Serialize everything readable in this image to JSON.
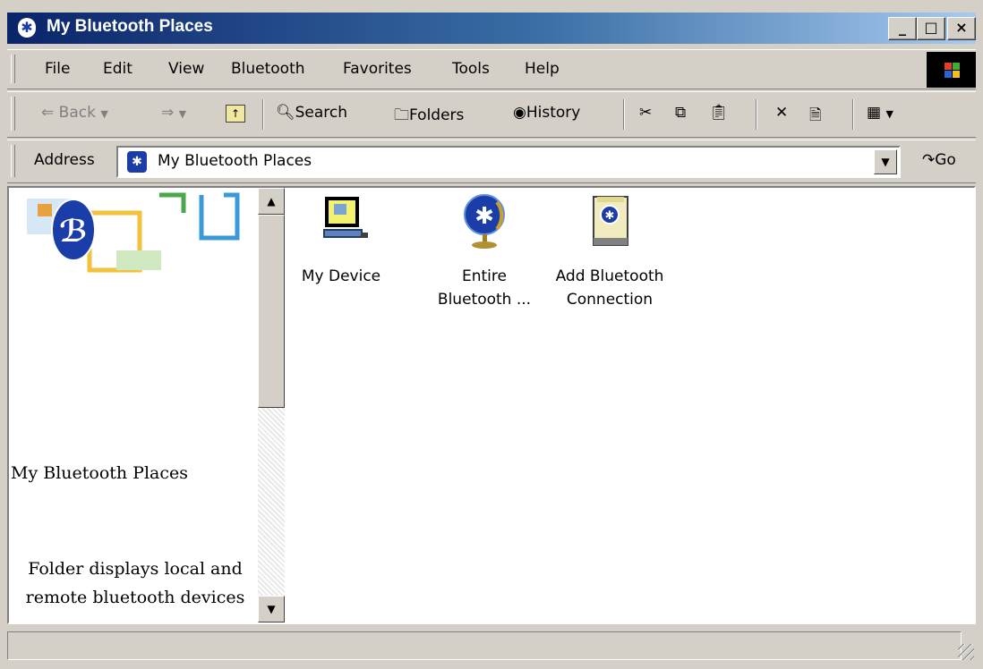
{
  "window": {
    "title": "My Bluetooth Places",
    "minimize_label": "_",
    "maximize_label": "□",
    "close_label": "×"
  },
  "menu": {
    "items": [
      {
        "label": "File"
      },
      {
        "label": "Edit"
      },
      {
        "label": "View"
      },
      {
        "label": "Bluetooth"
      },
      {
        "label": "Favorites"
      },
      {
        "label": "Tools"
      },
      {
        "label": "Help"
      }
    ]
  },
  "toolbar": {
    "back_label": "Back",
    "search_label": "Search",
    "folders_label": "Folders",
    "history_label": "History"
  },
  "address": {
    "label": "Address",
    "value": "My Bluetooth Places",
    "go_label": "Go"
  },
  "left_pane": {
    "title": "My Bluetooth Places",
    "description": "Folder displays local and remote bluetooth devices"
  },
  "items": [
    {
      "label": "My Device",
      "icon": "computer-icon"
    },
    {
      "label": "Entire Bluetooth ...",
      "icon": "bluetooth-globe-icon"
    },
    {
      "label": "Add Bluetooth Connection",
      "icon": "bluetooth-book-icon"
    }
  ],
  "colors": {
    "title_bar_start": "#0a246a",
    "title_bar_end": "#a6caf0",
    "bluetooth_blue": "#1a3da8",
    "window_face": "#d4d0c8"
  }
}
